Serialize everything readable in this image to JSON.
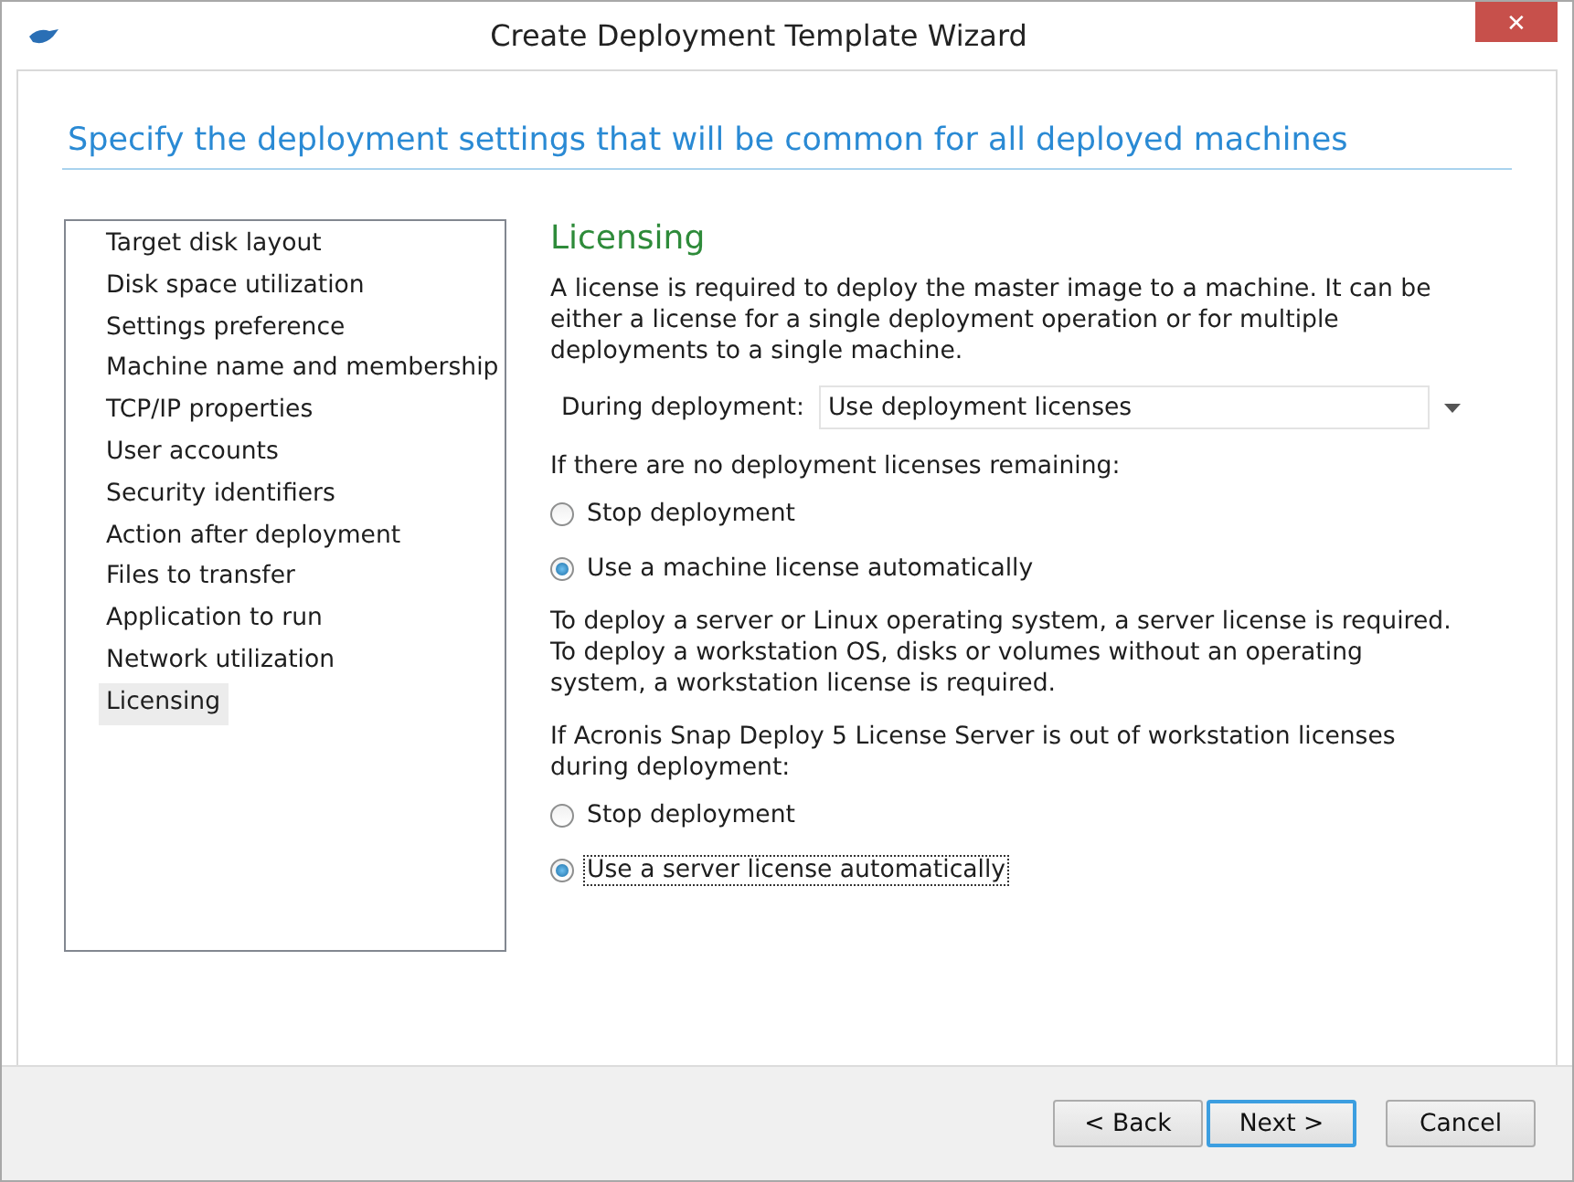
{
  "window": {
    "title": "Create Deployment Template Wizard",
    "close": "✕"
  },
  "header": {
    "title": "Specify the deployment settings that will be common for all deployed machines"
  },
  "steps": [
    {
      "label": "Target disk layout",
      "selected": false
    },
    {
      "label": "Disk space utilization",
      "selected": false
    },
    {
      "label": "Settings preference",
      "selected": false
    },
    {
      "label": "Machine name and membership",
      "selected": false
    },
    {
      "label": "TCP/IP properties",
      "selected": false
    },
    {
      "label": "User accounts",
      "selected": false
    },
    {
      "label": "Security identifiers",
      "selected": false
    },
    {
      "label": "Action after deployment",
      "selected": false
    },
    {
      "label": "Files to transfer",
      "selected": false
    },
    {
      "label": "Application to run",
      "selected": false
    },
    {
      "label": "Network utilization",
      "selected": false
    },
    {
      "label": "Licensing",
      "selected": true
    }
  ],
  "page": {
    "title": "Licensing",
    "intro": "A license is required to deploy the master image to a machine. It can be either a license for a single deployment operation or for multiple deployments to a single machine.",
    "dropdown": {
      "label": "During deployment:",
      "value": "Use deployment licenses"
    },
    "groups": [
      {
        "caption": "If there are no deployment licenses remaining:",
        "options": [
          {
            "label": "Stop deployment",
            "selected": false,
            "focused": false
          },
          {
            "label": "Use a machine license automatically",
            "selected": true,
            "focused": false
          }
        ]
      },
      {
        "note": "To deploy a server or Linux operating system, a server license is required. To deploy a workstation OS, disks or volumes without an operating system, a workstation license is required.",
        "caption": "If Acronis Snap Deploy 5 License Server is out of workstation licenses during deployment:",
        "options": [
          {
            "label": "Stop deployment",
            "selected": false,
            "focused": false
          },
          {
            "label": "Use a server license automatically",
            "selected": true,
            "focused": true
          }
        ]
      }
    ]
  },
  "buttons": [
    {
      "label": "< Back",
      "default": false
    },
    {
      "label": "Next >",
      "default": true
    },
    {
      "label": "Cancel",
      "default": false
    }
  ]
}
